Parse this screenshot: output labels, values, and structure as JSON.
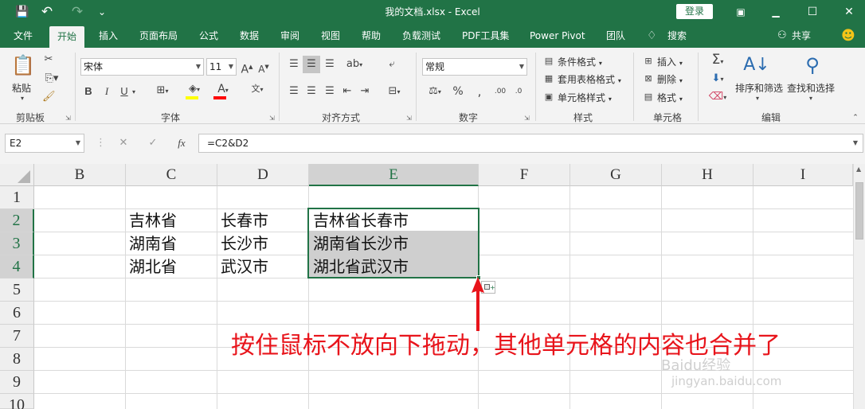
{
  "window": {
    "title": "我的文档.xlsx  -  Excel",
    "login_label": "登录",
    "minimize_icon": "▁",
    "restore_icon": "▢",
    "maximize_icon": "☐",
    "close_icon": "✕"
  },
  "qat": {
    "save_icon": "💾",
    "undo_icon": "↶",
    "redo_icon": "↷",
    "customize_icon": "⌄"
  },
  "tabs": [
    {
      "label": "文件"
    },
    {
      "label": "开始"
    },
    {
      "label": "插入"
    },
    {
      "label": "页面布局"
    },
    {
      "label": "公式"
    },
    {
      "label": "数据"
    },
    {
      "label": "审阅"
    },
    {
      "label": "视图"
    },
    {
      "label": "帮助"
    },
    {
      "label": "负载测试"
    },
    {
      "label": "PDF工具集"
    },
    {
      "label": "Power Pivot"
    },
    {
      "label": "团队"
    },
    {
      "label": "搜索"
    }
  ],
  "share_label": "共享",
  "ribbon": {
    "clipboard": {
      "paste": "粘贴",
      "label": "剪贴板"
    },
    "font": {
      "name": "宋体",
      "size": "11",
      "label": "字体",
      "bold": "B",
      "italic": "I",
      "underline": "U"
    },
    "alignment": {
      "label": "对齐方式"
    },
    "number": {
      "format": "常规",
      "label": "数字"
    },
    "styles": {
      "conditional": "条件格式",
      "table": "套用表格格式",
      "cell_styles": "单元格样式",
      "label": "样式"
    },
    "cells": {
      "insert": "插入",
      "delete": "删除",
      "format": "格式",
      "label": "单元格"
    },
    "editing": {
      "sort": "排序和筛选",
      "find": "查找和选择",
      "label": "编辑"
    }
  },
  "formula_bar": {
    "name_box": "E2",
    "cancel": "✕",
    "enter": "✓",
    "fx": "fx",
    "formula": "=C2&D2"
  },
  "sheet": {
    "columns": [
      "B",
      "C",
      "D",
      "E",
      "F",
      "G",
      "H",
      "I"
    ],
    "rows": [
      "1",
      "2",
      "3",
      "4",
      "5",
      "6",
      "7",
      "8",
      "9",
      "10"
    ],
    "cells": {
      "C2": "吉林省",
      "D2": "长春市",
      "E2": "吉林省长春市",
      "C3": "湖南省",
      "D3": "长沙市",
      "E3": "湖南省长沙市",
      "C4": "湖北省",
      "D4": "武汉市",
      "E4": "湖北省武汉市"
    }
  },
  "annotation": "按住鼠标不放向下拖动，其他单元格的内容也合并了",
  "watermark": {
    "line1": "Baidu经验",
    "line2": "jingyan.baidu.com"
  },
  "colors": {
    "accent": "#217346",
    "annotation": "#e8141b"
  }
}
